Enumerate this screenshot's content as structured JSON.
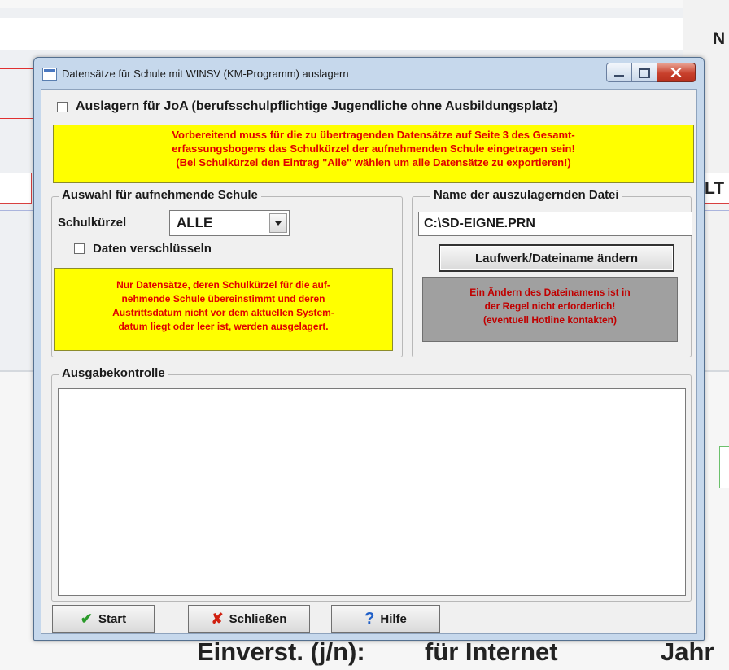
{
  "background": {
    "right_text_top": "N",
    "right_text_mid": "LT",
    "bottom_text_1": "Einverst. (j/n):",
    "bottom_text_2": "für Internet",
    "bottom_text_3": "Jahr"
  },
  "window": {
    "title": "Datensätze für Schule mit WINSV (KM-Programm) auslagern"
  },
  "joa_checkbox": {
    "label": "Auslagern für JoA (berufsschulpflichtige Jugendliche ohne Ausbildungsplatz)",
    "checked": false
  },
  "notice": {
    "line1": "Vorbereitend muss für die zu übertragenden Datensätze auf Seite 3 des Gesamt-",
    "line2": "erfassungsbogens das Schulkürzel der aufnehmenden Schule eingetragen sein!",
    "line3": "(Bei Schulkürzel den Eintrag \"Alle\" wählen um alle Datensätze zu exportieren!)"
  },
  "school_group": {
    "legend": "Auswahl für aufnehmende Schule",
    "code_label": "Schulkürzel",
    "code_value": "ALLE",
    "encrypt_label": "Daten verschlüsseln",
    "encrypt_checked": false,
    "info_line1": "Nur Datensätze, deren Schulkürzel für die auf-",
    "info_line2": "nehmende Schule übereinstimmt und deren",
    "info_line3": "Austrittsdatum nicht vor dem aktuellen System-",
    "info_line4": "datum liegt oder leer ist, werden ausgelagert."
  },
  "file_group": {
    "legend": "Name der auszulagernden Datei",
    "filename": "C:\\SD-EIGNE.PRN",
    "change_button": "Laufwerk/Dateiname ändern",
    "hint_line1": "Ein Ändern des Dateinamens ist in",
    "hint_line2": "der Regel nicht erforderlich!",
    "hint_line3": "(eventuell Hotline kontakten)"
  },
  "output_group": {
    "legend": "Ausgabekontrolle",
    "content": ""
  },
  "buttons": {
    "start": "Start",
    "close": "Schließen",
    "help_underlined": "H",
    "help_rest": "ilfe"
  },
  "colors": {
    "notice_bg": "#ffff00",
    "notice_text": "#e00000",
    "hint_bg": "#a0a0a0"
  },
  "icons": {
    "start": "checkmark-icon",
    "close": "x-icon",
    "help": "question-icon"
  }
}
